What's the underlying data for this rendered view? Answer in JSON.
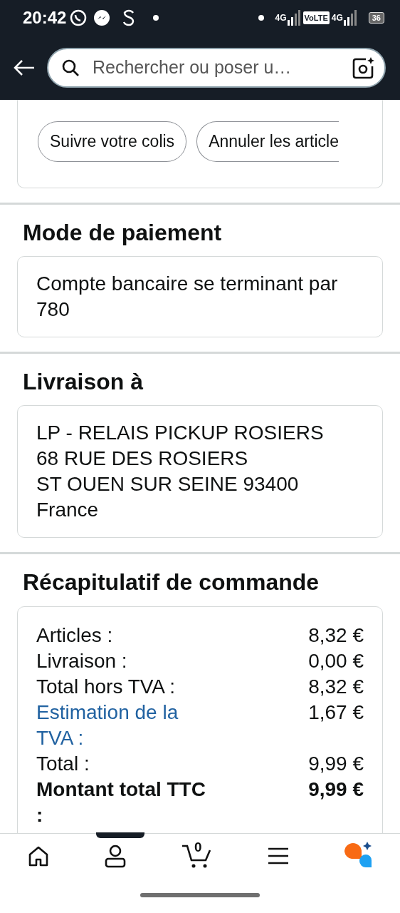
{
  "status_bar": {
    "time": "20:42",
    "network_1": "4G",
    "volte": "VoLTE",
    "network_2": "4G",
    "battery": "36"
  },
  "header": {
    "search": {
      "placeholder": "Rechercher ou poser u…"
    }
  },
  "order_actions": [
    "Suivre votre colis",
    "Annuler les article"
  ],
  "payment": {
    "title": "Mode de paiement",
    "text": "Compte bancaire se terminant par 780"
  },
  "delivery": {
    "title": "Livraison à",
    "lines": [
      "LP - RELAIS PICKUP ROSIERS",
      "68 RUE DES ROSIERS",
      "ST OUEN SUR SEINE 93400",
      "France"
    ]
  },
  "summary": {
    "title": "Récapitulatif de commande",
    "rows": [
      {
        "label": "Articles :",
        "value": "8,32 €",
        "kind": "plain"
      },
      {
        "label": "Livraison :",
        "value": "0,00 €",
        "kind": "plain"
      },
      {
        "label": "Total hors TVA :",
        "value": "8,32 €",
        "kind": "plain"
      },
      {
        "label": "Estimation de la TVA :",
        "value": "1,67 €",
        "kind": "link"
      },
      {
        "label": "Total :",
        "value": "9,99 €",
        "kind": "plain"
      },
      {
        "label": "Montant total TTC :",
        "value": "9,99 €",
        "kind": "bold"
      }
    ]
  },
  "bottom_nav": {
    "cart_count": "0"
  }
}
